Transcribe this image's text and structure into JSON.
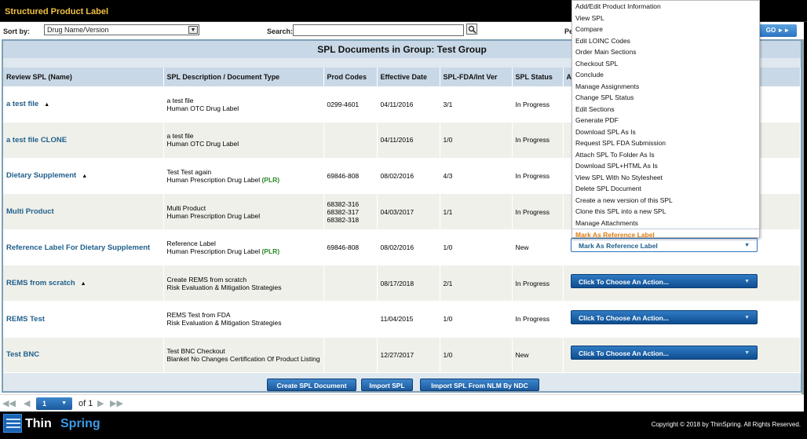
{
  "app": {
    "title": "Structured Product Label"
  },
  "filters": {
    "sort_label": "Sort by:",
    "sort_value": "Drug Name/Version",
    "search_label": "Search:",
    "search_value": "",
    "pe_label": "Pe",
    "go_label": "GO ►►"
  },
  "group": {
    "title": "SPL Documents in Group: Test Group"
  },
  "columns": [
    "Review SPL (Name)",
    "SPL Description / Document Type",
    "Prod Codes",
    "Effective Date",
    "SPL-FDA/Int Ver",
    "SPL Status",
    "Ac"
  ],
  "rows": [
    {
      "name": "a test file",
      "desc1": "a test file",
      "desc2": "Human OTC Drug Label",
      "plr": "",
      "codes": "0299-4601",
      "date": "04/11/2016",
      "ver": "3/1",
      "status": "In Progress",
      "action": ""
    },
    {
      "name": "a test file CLONE",
      "desc1": "a test file",
      "desc2": "Human OTC Drug Label",
      "plr": "",
      "codes": "",
      "date": "04/11/2016",
      "ver": "1/0",
      "status": "In Progress",
      "action": ""
    },
    {
      "name": "Dietary Supplement",
      "desc1": "Test Test again",
      "desc2": "Human Prescription Drug Label",
      "plr": "(PLR)",
      "codes": "69846-808",
      "date": "08/02/2016",
      "ver": "4/3",
      "status": "In Progress",
      "action": ""
    },
    {
      "name": "Multi Product",
      "desc1": "Multi Product",
      "desc2": "Human Prescription Drug Label",
      "plr": "",
      "codes": "68382-316\n68382-317\n68382-318",
      "date": "04/03/2017",
      "ver": "1/1",
      "status": "In Progress",
      "action": ""
    },
    {
      "name": "Reference Label For Dietary Supplement",
      "desc1": "Reference Label",
      "desc2": "Human Prescription Drug Label",
      "plr": "(PLR)",
      "codes": "69846-808",
      "date": "08/02/2016",
      "ver": "1/0",
      "status": "New",
      "action": "Mark As Reference Label"
    },
    {
      "name": "REMS from scratch",
      "desc1": "Create REMS from scratch",
      "desc2": "Risk Evaluation & Mitigation Strategies",
      "plr": "",
      "codes": "",
      "date": "08/17/2018",
      "ver": "2/1",
      "status": "In Progress",
      "action": "Click To Choose An Action..."
    },
    {
      "name": "REMS Test",
      "desc1": "REMS Test from FDA",
      "desc2": "Risk Evaluation & Mitigation Strategies",
      "plr": "",
      "codes": "",
      "date": "11/04/2015",
      "ver": "1/0",
      "status": "In Progress",
      "action": "Click To Choose An Action..."
    },
    {
      "name": "Test BNC",
      "desc1": "Test BNC Checkout",
      "desc2": "Blanket No Changes Certification Of Product Listing",
      "plr": "",
      "codes": "",
      "date": "12/27/2017",
      "ver": "1/0",
      "status": "New",
      "action": "Click To Choose An Action..."
    }
  ],
  "footer_buttons": [
    "Create SPL Document",
    "Import SPL",
    "Import SPL From NLM By NDC"
  ],
  "pager": {
    "page": "1",
    "of": "of 1"
  },
  "action_menu": [
    "Add/Edit Product Information",
    "View SPL",
    "Compare",
    "Edit LOINC Codes",
    "Order Main Sections",
    "Checkout SPL",
    "Conclude",
    "Manage Assignments",
    "Change SPL Status",
    "Edit Sections",
    "Generate PDF",
    "Download SPL As Is",
    "Request SPL FDA Submission",
    "Attach SPL To Folder As Is",
    "Download SPL+HTML As Is",
    "View SPL With No Stylesheet",
    "Delete SPL Document",
    "Create a new version of this SPL",
    "Clone this SPL into a new SPL",
    "Manage Attachments",
    "Mark As Reference Label"
  ],
  "action_menu_active": "Mark As Reference Label",
  "brand": {
    "word1": "Thin",
    "word2": "Spring"
  },
  "copyright": "Copyright © 2018 by ThinSpring. All Rights Reserved.",
  "colors": {
    "title": "#f0c040",
    "link": "#1f5f8c",
    "accent": "#2c73c0",
    "plr": "#2a8a2a",
    "menu_active": "#e07a10"
  }
}
